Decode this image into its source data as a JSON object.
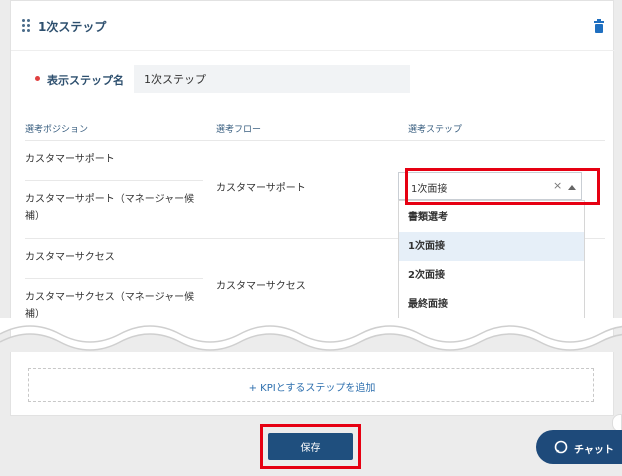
{
  "step": {
    "title": "1次ステップ",
    "name_label": "表示ステップ名",
    "name_value": "1次ステップ"
  },
  "table": {
    "headers": [
      "選考ポジション",
      "選考フロー",
      "選考ステップ"
    ],
    "positions": [
      "カスタマーサポート",
      "カスタマーサポート（マネージャー候補）",
      "カスタマーサクセス",
      "カスタマーサクセス（マネージャー候補）"
    ],
    "flows": [
      "カスタマーサポート",
      "カスタマーサクセス"
    ]
  },
  "select": {
    "value": "1次面接",
    "clear": "×",
    "options": [
      "書類選考",
      "1次面接",
      "2次面接",
      "最終面接"
    ],
    "highlighted_index": 1
  },
  "kpi": {
    "add_label": "+ KPIとするステップを追加"
  },
  "actions": {
    "save_label": "保存"
  },
  "chat": {
    "label": "チャット"
  },
  "colors": {
    "primary": "#1f4f7e",
    "highlight_box": "#e60012",
    "required": "#e04040"
  }
}
